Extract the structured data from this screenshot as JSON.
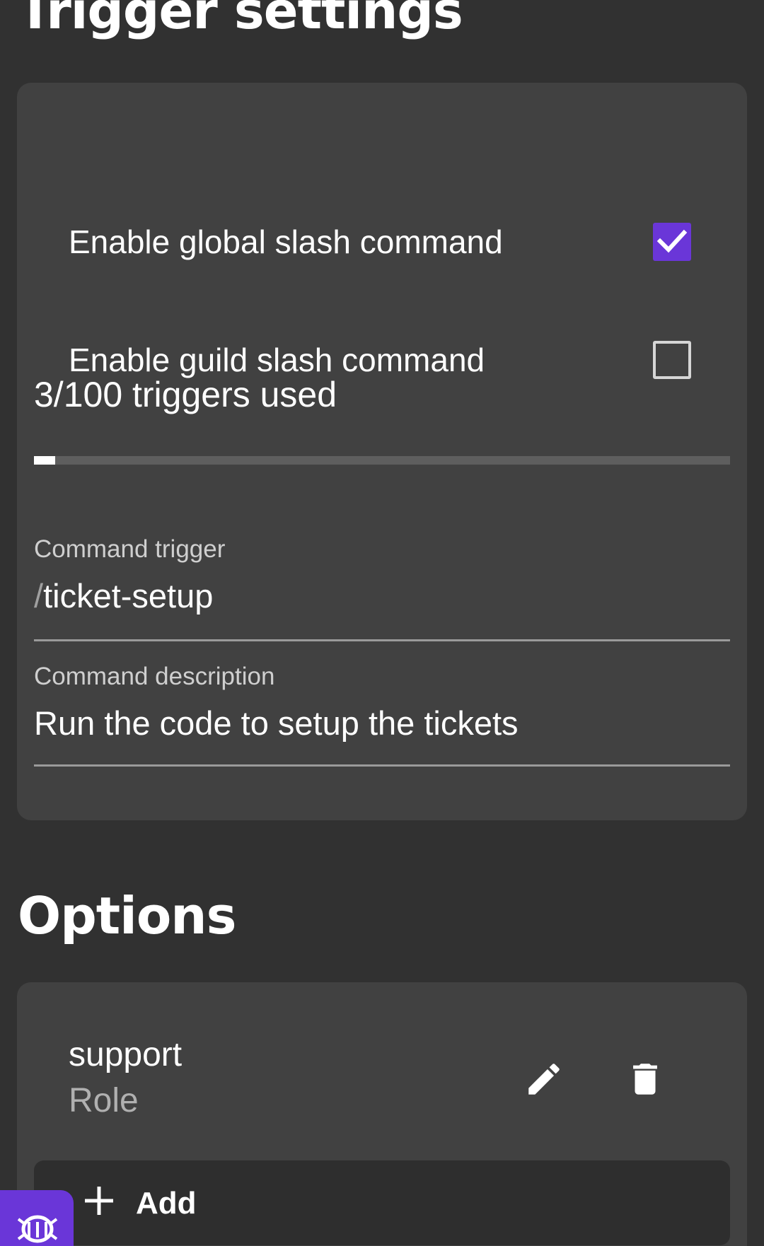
{
  "trigger_settings": {
    "title": "Trigger settings",
    "global_slash": {
      "label": "Enable global slash command",
      "checked": true
    },
    "guild_slash": {
      "label": "Enable guild slash command",
      "checked": false
    },
    "usage": {
      "text": "3/100 triggers used",
      "used": 3,
      "max": 100
    },
    "command_trigger": {
      "label": "Command trigger",
      "prefix": "/",
      "value": "ticket-setup"
    },
    "command_description": {
      "label": "Command description",
      "value": "Run the code to setup the tickets"
    }
  },
  "options": {
    "title": "Options",
    "items": [
      {
        "name": "support",
        "type": "Role",
        "edit_icon": "pencil-icon",
        "delete_icon": "trash-icon"
      }
    ],
    "add_label": "Add",
    "add_icon": "plus-icon"
  },
  "floating_widget_icon": "bug-icon",
  "colors": {
    "background": "#313131",
    "card": "#414141",
    "accent": "#6a36d8"
  }
}
